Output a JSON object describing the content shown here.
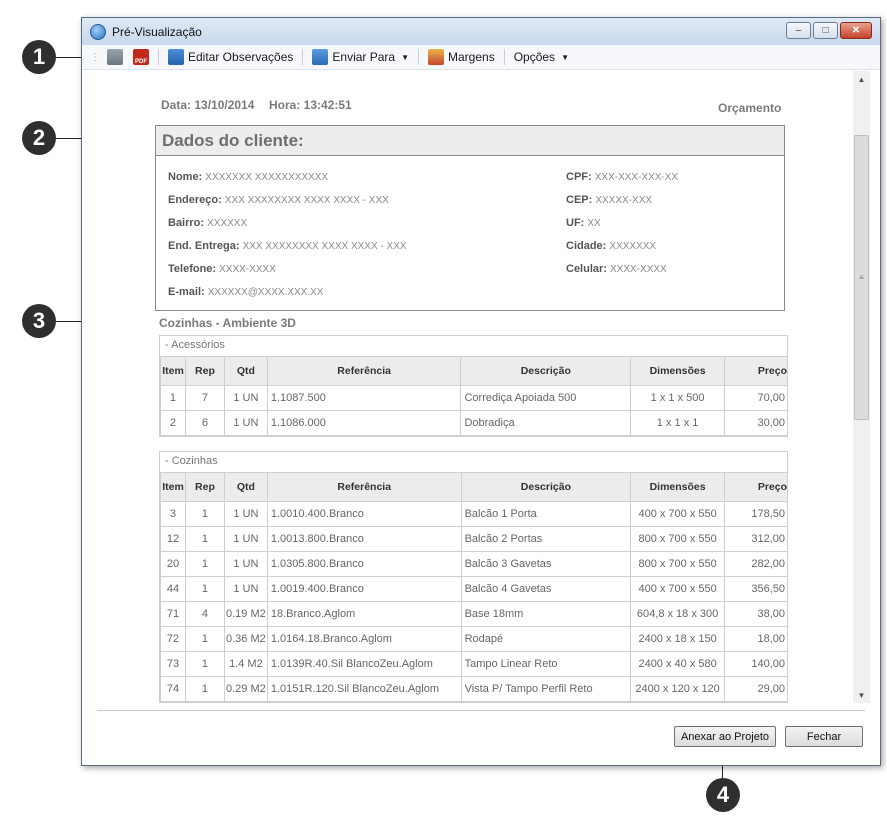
{
  "window": {
    "title": "Pré-Visualização",
    "controls": {
      "minimize": "–",
      "maximize": "□",
      "close": "✕"
    }
  },
  "toolbar": {
    "edit_notes": "Editar Observações",
    "send_to": "Enviar Para",
    "margins": "Margens",
    "options": "Opções",
    "pdf_icon_text": "PDF"
  },
  "report": {
    "date_label": "Data: 13/10/2014",
    "time_label": "Hora: 13:42:51",
    "doc_type": "Orçamento",
    "client_title": "Dados do cliente:",
    "client_fields": {
      "nome_label": "Nome:",
      "nome": "XXXXXXX XXXXXXXXXXX",
      "endereco_label": "Endereço:",
      "endereco": "XXX XXXXXXXX XXXX XXXX - XXX",
      "bairro_label": "Bairro:",
      "bairro": "XXXXXX",
      "entrega_label": "End. Entrega:",
      "entrega": "XXX XXXXXXXX XXXX XXXX - XXX",
      "telefone_label": "Telefone:",
      "telefone": "XXXX-XXXX",
      "email_label": "E-mail:",
      "email": "XXXXXX@XXXX.XXX.XX",
      "cpf_label": "CPF:",
      "cpf": "XXX-XXX-XXX-XX",
      "cep_label": "CEP:",
      "cep": "XXXXX-XXX",
      "uf_label": "UF:",
      "uf": "XX",
      "cidade_label": "Cidade:",
      "cidade": "XXXXXXX",
      "celular_label": "Celular:",
      "celular": "XXXX-XXXX"
    },
    "section_title": "Cozinhas - Ambiente 3D",
    "columns": [
      "Item",
      "Rep",
      "Qtd",
      "Referência",
      "Descrição",
      "Dimensões",
      "Preço"
    ],
    "groups": [
      {
        "title": "- Acessórios",
        "rows": [
          [
            "1",
            "7",
            "1 UN",
            "1.1087.500",
            "Corrediça Apoiada 500",
            "1 x 1 x 500",
            "70,00"
          ],
          [
            "2",
            "6",
            "1 UN",
            "1.1086.000",
            "Dobradiça",
            "1 x 1 x 1",
            "30,00"
          ]
        ]
      },
      {
        "title": "- Cozinhas",
        "rows": [
          [
            "3",
            "1",
            "1 UN",
            "1.0010.400.Branco",
            "Balcão 1 Porta",
            "400 x 700 x 550",
            "178,50"
          ],
          [
            "12",
            "1",
            "1 UN",
            "1.0013.800.Branco",
            "Balcão 2 Portas",
            "800 x 700 x 550",
            "312,00"
          ],
          [
            "20",
            "1",
            "1 UN",
            "1.0305.800.Branco",
            "Balcão 3 Gavetas",
            "800 x 700 x 550",
            "282,00"
          ],
          [
            "44",
            "1",
            "1 UN",
            "1.0019.400.Branco",
            "Balcão 4 Gavetas",
            "400 x 700 x 550",
            "356,50"
          ],
          [
            "71",
            "4",
            "0.19 M2",
            "18.Branco.Aglom",
            "Base 18mm",
            "604,8 x 18 x 300",
            "38,00"
          ],
          [
            "72",
            "1",
            "0.36 M2",
            "1.0164.18.Branco.Aglom",
            "Rodapé",
            "2400 x 18 x 150",
            "18,00"
          ],
          [
            "73",
            "1",
            "1.4 M2",
            "1.0139R.40.Sil BlancoZeu.Aglom",
            "Tampo Linear Reto",
            "2400 x 40 x 580",
            "140,00"
          ],
          [
            "74",
            "1",
            "0.29 M2",
            "1.0151R.120.Sil BlancoZeu.Aglom",
            "Vista P/ Tampo Perfil Reto",
            "2400 x 120 x 120",
            "29,00"
          ]
        ]
      }
    ]
  },
  "buttons": {
    "attach": "Anexar ao Projeto",
    "close": "Fechar"
  },
  "callouts": [
    "1",
    "2",
    "3",
    "4"
  ]
}
